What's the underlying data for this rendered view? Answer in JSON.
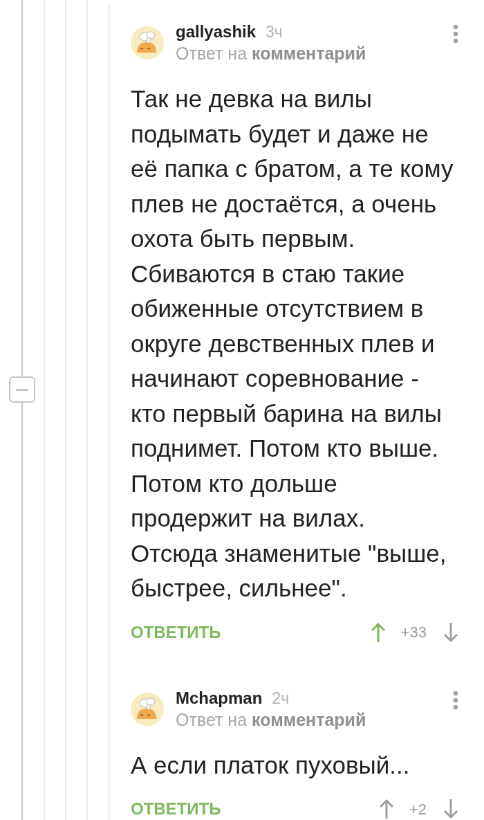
{
  "comments": [
    {
      "author": "gallyashik",
      "time": "3ч",
      "reply_to": "Ответ на **комментарий**",
      "text": "Так не девка на вилы подымать будет и даже не её папка с братом, а те кому плев не достаётся, а очень охота быть первым. Сбиваются в стаю такие обиженные отсутствием в округе девственных плев и начинают соревнование - кто первый барина на вилы поднимет. Потом кто выше. Потом кто дольше продержит на вилах. Отсюда знаменитые \"выше, быстрее, сильнее\".",
      "reply_button": "ОТВЕТИТЬ",
      "rating": "+33",
      "upvoted": true,
      "downvoted": false
    },
    {
      "author": "Mchapman",
      "time": "2ч",
      "reply_to": "Ответ на **комментарий**",
      "text": "А если платок пуховый...",
      "reply_button": "ОТВЕТИТЬ",
      "rating": "+2",
      "upvoted": false,
      "downvoted": false
    }
  ]
}
